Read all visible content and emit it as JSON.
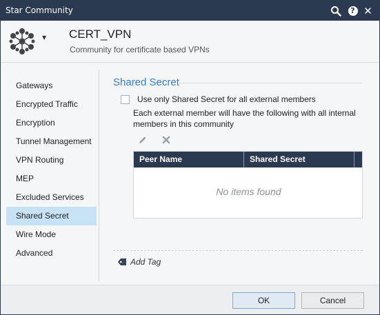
{
  "window": {
    "title": "Star Community"
  },
  "titlebar_icons": {
    "search": "search-icon",
    "help": "?",
    "help_icon": "help-icon",
    "close": "✕",
    "close_icon": "close-icon"
  },
  "header": {
    "name": "CERT_VPN",
    "subtitle": "Community for certificate based VPNs",
    "logo_icon": "star-community-icon"
  },
  "sidebar": {
    "items": [
      {
        "label": "Gateways"
      },
      {
        "label": "Encrypted Traffic"
      },
      {
        "label": "Encryption"
      },
      {
        "label": "Tunnel Management"
      },
      {
        "label": "VPN Routing"
      },
      {
        "label": "MEP"
      },
      {
        "label": "Excluded Services"
      },
      {
        "label": "Shared Secret"
      },
      {
        "label": "Wire Mode"
      },
      {
        "label": "Advanced"
      }
    ],
    "active_label": "Shared Secret"
  },
  "main": {
    "section_title": "Shared Secret",
    "checkbox_label": "Use only Shared Secret for all external members",
    "checkbox_checked": false,
    "description": "Each external member will have the following with all internal members in this community",
    "toolbar": {
      "edit_icon": "pencil-icon",
      "delete_icon": "delete-icon"
    },
    "table": {
      "columns": [
        "Peer Name",
        "Shared Secret"
      ],
      "rows": [],
      "empty_text": "No items found"
    },
    "add_tag_label": "Add Tag"
  },
  "footer": {
    "ok_label": "OK",
    "cancel_label": "Cancel"
  },
  "colors": {
    "titlebar": "#2c3a51",
    "accent": "#3a7cc0",
    "active_item": "#c7e1f5"
  }
}
